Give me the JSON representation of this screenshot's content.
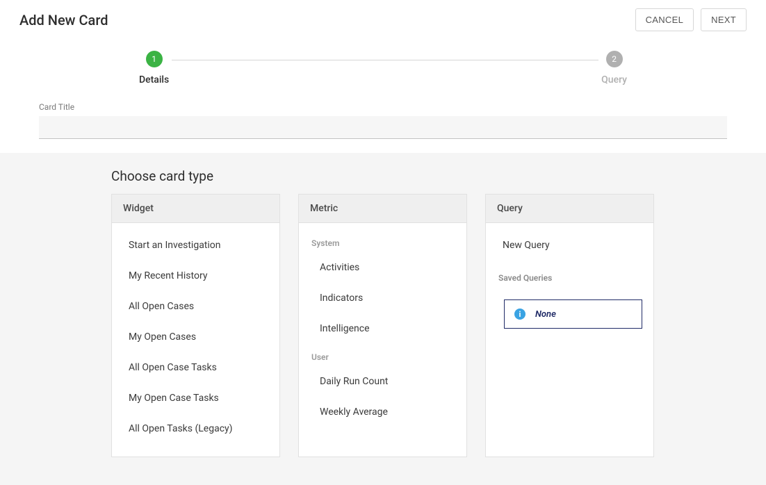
{
  "header": {
    "title": "Add New Card",
    "cancel_label": "CANCEL",
    "next_label": "NEXT"
  },
  "stepper": {
    "step1": {
      "number": "1",
      "label": "Details"
    },
    "step2": {
      "number": "2",
      "label": "Query"
    }
  },
  "form": {
    "card_title_label": "Card Title",
    "card_title_value": ""
  },
  "choose": {
    "title": "Choose card type",
    "widget": {
      "header": "Widget",
      "items": [
        "Start an Investigation",
        "My Recent History",
        "All Open Cases",
        "My Open Cases",
        "All Open Case Tasks",
        "My Open Case Tasks",
        "All Open Tasks (Legacy)"
      ]
    },
    "metric": {
      "header": "Metric",
      "system_label": "System",
      "system_items": [
        "Activities",
        "Indicators",
        "Intelligence"
      ],
      "user_label": "User",
      "user_items": [
        "Daily Run Count",
        "Weekly Average"
      ]
    },
    "query": {
      "header": "Query",
      "new_query": "New Query",
      "saved_label": "Saved Queries",
      "none_label": "None"
    }
  }
}
